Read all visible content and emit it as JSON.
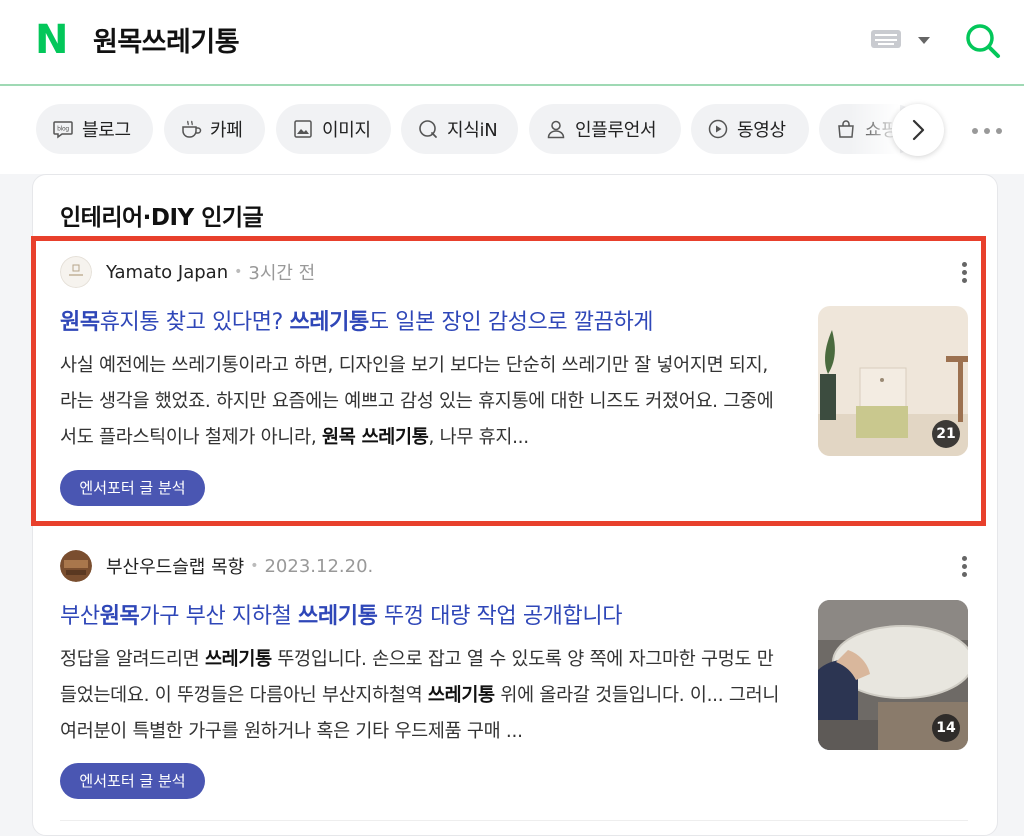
{
  "header": {
    "logo": "N",
    "query": "원목쓰레기통"
  },
  "tabs": [
    {
      "label": "블로그",
      "icon": "blog-icon"
    },
    {
      "label": "카페",
      "icon": "cafe-cup-icon"
    },
    {
      "label": "이미지",
      "icon": "image-icon"
    },
    {
      "label": "지식iN",
      "icon": "knowledge-icon"
    },
    {
      "label": "인플루언서",
      "icon": "person-icon"
    },
    {
      "label": "동영상",
      "icon": "play-icon"
    },
    {
      "label": "쇼핑",
      "icon": "shopping-bag-icon"
    }
  ],
  "section": {
    "title": "인테리어·DIY 인기글"
  },
  "posts": [
    {
      "author": "Yamato Japan",
      "time": "3시간 전",
      "title_parts": [
        "원목",
        "휴지통 찾고 있다면? ",
        "쓰레기통",
        "도 일본 장인 감성으로 깔끔하게"
      ],
      "body_parts": [
        "사실 예전에는 쓰레기통이라고 하면, 디자인을 보기 보다는 단순히 쓰레기만 잘 넣어지면 되지, 라는 생각을 했었죠. 하지만 요즘에는 예쁘고 감성 있는 휴지통에 대한 니즈도 커졌어요. 그중에서도 플라스틱이나 철제가 아니라, ",
        "원목 쓰레기통",
        ", 나무 휴지..."
      ],
      "button": "엔서포터 글 분석",
      "image_count": "21",
      "highlighted": true
    },
    {
      "author": "부산우드슬랩 목향",
      "time": "2023.12.20.",
      "title_parts": [
        "부산",
        "원목",
        "가구 부산 지하철 ",
        "쓰레기통",
        " 뚜껑 대량 작업 공개합니다"
      ],
      "body_parts": [
        "정답을 알려드리면 ",
        "쓰레기통",
        " 뚜껑입니다. 손으로 잡고 열 수 있도록 양 쪽에 자그마한 구멍도 만들었는데요. 이 뚜껑들은 다름아닌 부산지하철역 ",
        "쓰레기통",
        " 위에 올라갈 것들입니다. 이... 그러니 여러분이 특별한 가구를 원하거나 혹은 기타 우드제품 구매 ..."
      ],
      "button": "엔서포터 글 분석",
      "image_count": "14",
      "highlighted": false
    }
  ],
  "colors": {
    "brand": "#03c75a",
    "link": "#2f47b8",
    "highlight_border": "#e8402c",
    "button": "#4a56b2"
  }
}
